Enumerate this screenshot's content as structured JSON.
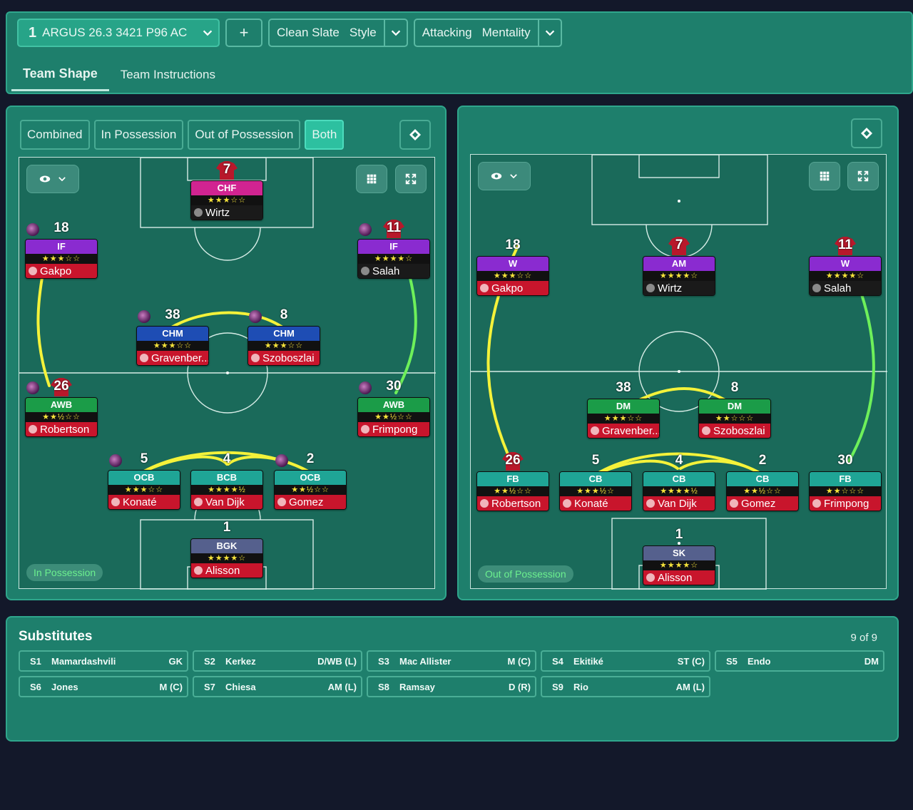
{
  "topbar": {
    "tactic_number": "1",
    "tactic_name": "ARGUS 26.3 3421 P96 AC",
    "add_label": "+",
    "style_value": "Clean Slate",
    "style_label": "Style",
    "mentality_value": "Attacking",
    "mentality_label": "Mentality",
    "tabs": [
      "Team Shape",
      "Team Instructions"
    ]
  },
  "left_panel": {
    "modes": [
      "Combined",
      "In Possession",
      "Out of Possession",
      "Both"
    ],
    "active_mode": "Both",
    "badge": "In Possession",
    "players": [
      {
        "number": "7",
        "role": "CHF",
        "stars": "★★★☆☆",
        "name": "Wirtz"
      },
      {
        "number": "18",
        "role": "IF",
        "stars": "★★★☆☆",
        "name": "Gakpo"
      },
      {
        "number": "11",
        "role": "IF",
        "stars": "★★★★☆",
        "name": "Salah"
      },
      {
        "number": "38",
        "role": "CHM",
        "stars": "★★★☆☆",
        "name": "Gravenber..."
      },
      {
        "number": "8",
        "role": "CHM",
        "stars": "★★★☆☆",
        "name": "Szoboszlai"
      },
      {
        "number": "26",
        "role": "AWB",
        "stars": "★★½☆☆",
        "name": "Robertson"
      },
      {
        "number": "30",
        "role": "AWB",
        "stars": "★★½☆☆",
        "name": "Frimpong"
      },
      {
        "number": "5",
        "role": "OCB",
        "stars": "★★★☆☆",
        "name": "Konaté"
      },
      {
        "number": "4",
        "role": "BCB",
        "stars": "★★★★½",
        "name": "Van Dijk"
      },
      {
        "number": "2",
        "role": "OCB",
        "stars": "★★½☆☆",
        "name": "Gomez"
      },
      {
        "number": "1",
        "role": "BGK",
        "stars": "★★★★☆",
        "name": "Alisson"
      }
    ]
  },
  "right_panel": {
    "badge": "Out of Possession",
    "players": [
      {
        "number": "18",
        "role": "W",
        "stars": "★★★☆☆",
        "name": "Gakpo"
      },
      {
        "number": "7",
        "role": "AM",
        "stars": "★★★★☆",
        "name": "Wirtz"
      },
      {
        "number": "11",
        "role": "W",
        "stars": "★★★★☆",
        "name": "Salah"
      },
      {
        "number": "38",
        "role": "DM",
        "stars": "★★★☆☆",
        "name": "Gravenber..."
      },
      {
        "number": "8",
        "role": "DM",
        "stars": "★★☆☆☆",
        "name": "Szoboszlai"
      },
      {
        "number": "26",
        "role": "FB",
        "stars": "★★½☆☆",
        "name": "Robertson"
      },
      {
        "number": "5",
        "role": "CB",
        "stars": "★★★½☆",
        "name": "Konaté"
      },
      {
        "number": "4",
        "role": "CB",
        "stars": "★★★★½",
        "name": "Van Dijk"
      },
      {
        "number": "2",
        "role": "CB",
        "stars": "★★½☆☆",
        "name": "Gomez"
      },
      {
        "number": "30",
        "role": "FB",
        "stars": "★★☆☆☆",
        "name": "Frimpong"
      },
      {
        "number": "1",
        "role": "SK",
        "stars": "★★★★☆",
        "name": "Alisson"
      }
    ]
  },
  "substitutes": {
    "title": "Substitutes",
    "count": "9 of 9",
    "items": [
      {
        "slot": "S1",
        "name": "Mamardashvili",
        "pos": "GK"
      },
      {
        "slot": "S2",
        "name": "Kerkez",
        "pos": "D/WB (L)"
      },
      {
        "slot": "S3",
        "name": "Mac Allister",
        "pos": "M (C)"
      },
      {
        "slot": "S4",
        "name": "Ekitiké",
        "pos": "ST (C)"
      },
      {
        "slot": "S5",
        "name": "Endo",
        "pos": "DM"
      },
      {
        "slot": "S6",
        "name": "Jones",
        "pos": "M (C)"
      },
      {
        "slot": "S7",
        "name": "Chiesa",
        "pos": "AM (L)"
      },
      {
        "slot": "S8",
        "name": "Ramsay",
        "pos": "D (R)"
      },
      {
        "slot": "S9",
        "name": "Rio",
        "pos": "AM (L)"
      }
    ]
  },
  "colors": {
    "panel": "#1e7f6c",
    "pitch": "#1a6a5a",
    "accent": "#2dc0a0",
    "link_yellow": "#f4f23a",
    "link_green": "#6ef05a"
  },
  "icons": [
    "chevron-down-icon",
    "eye-icon",
    "grid-icon",
    "expand-icon",
    "diamond-icon",
    "person-icon",
    "kit-icon"
  ]
}
